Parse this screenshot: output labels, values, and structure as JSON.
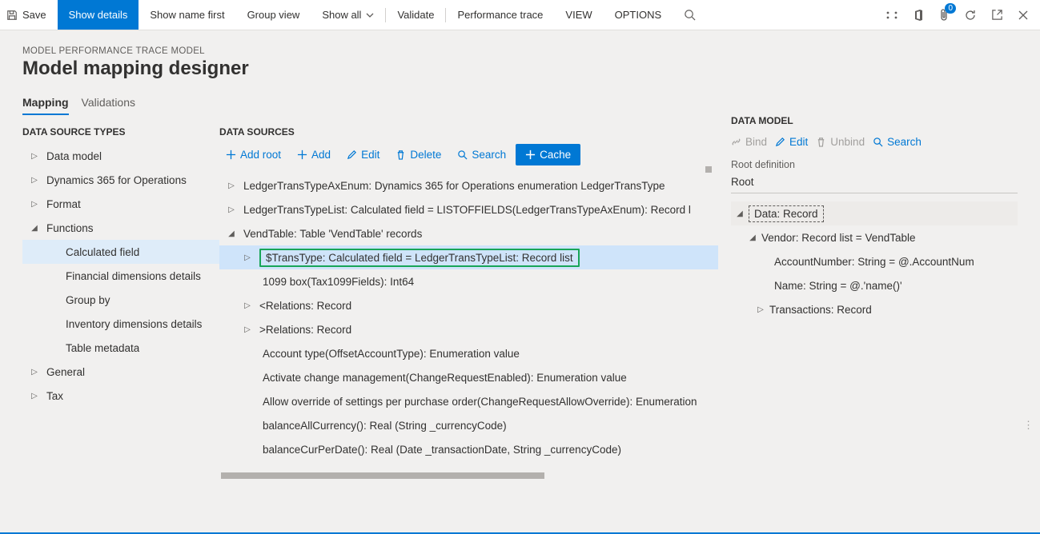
{
  "cmdbar": {
    "save": "Save",
    "show_details": "Show details",
    "show_name_first": "Show name first",
    "group_view": "Group view",
    "show_all": "Show all",
    "validate": "Validate",
    "perf_trace": "Performance trace",
    "view": "VIEW",
    "options": "OPTIONS",
    "notif_count": "0"
  },
  "header": {
    "context": "MODEL PERFORMANCE TRACE MODEL",
    "title": "Model mapping designer"
  },
  "tabs": {
    "mapping": "Mapping",
    "validations": "Validations"
  },
  "col1": {
    "title": "DATA SOURCE TYPES",
    "items": [
      {
        "label": "Data model"
      },
      {
        "label": "Dynamics 365 for Operations"
      },
      {
        "label": "Format"
      },
      {
        "label": "Functions"
      },
      {
        "label": "General"
      },
      {
        "label": "Tax"
      }
    ],
    "fn_children": [
      "Calculated field",
      "Financial dimensions details",
      "Group by",
      "Inventory dimensions details",
      "Table metadata"
    ]
  },
  "col2": {
    "title": "DATA SOURCES",
    "buttons": {
      "addroot": "Add root",
      "add": "Add",
      "edit": "Edit",
      "delete": "Delete",
      "search": "Search",
      "cache": "Cache"
    },
    "nodes": {
      "n0": "LedgerTransTypeAxEnum: Dynamics 365 for Operations enumeration LedgerTransType",
      "n1": "LedgerTransTypeList: Calculated field = LISTOFFIELDS(LedgerTransTypeAxEnum): Record l",
      "n2": "VendTable: Table 'VendTable' records",
      "n3": "$TransType: Calculated field = LedgerTransTypeList: Record list",
      "n4": "1099 box(Tax1099Fields): Int64",
      "n5": "<Relations: Record",
      "n6": ">Relations: Record",
      "n7": "Account type(OffsetAccountType): Enumeration value",
      "n8": "Activate change management(ChangeRequestEnabled): Enumeration value",
      "n9": "Allow override of settings per purchase order(ChangeRequestAllowOverride): Enumeration",
      "n10": "balanceAllCurrency(): Real (String _currencyCode)",
      "n11": "balanceCurPerDate(): Real (Date _transactionDate, String _currencyCode)"
    }
  },
  "col3": {
    "title": "DATA MODEL",
    "actions": {
      "bind": "Bind",
      "edit": "Edit",
      "unbind": "Unbind",
      "search": "Search"
    },
    "root_label": "Root definition",
    "root_value": "Root",
    "nodes": {
      "d0": "Data: Record",
      "d1": "Vendor: Record list = VendTable",
      "d2": "AccountNumber: String = @.AccountNum",
      "d3": "Name: String = @.'name()'",
      "d4": "Transactions: Record"
    }
  }
}
